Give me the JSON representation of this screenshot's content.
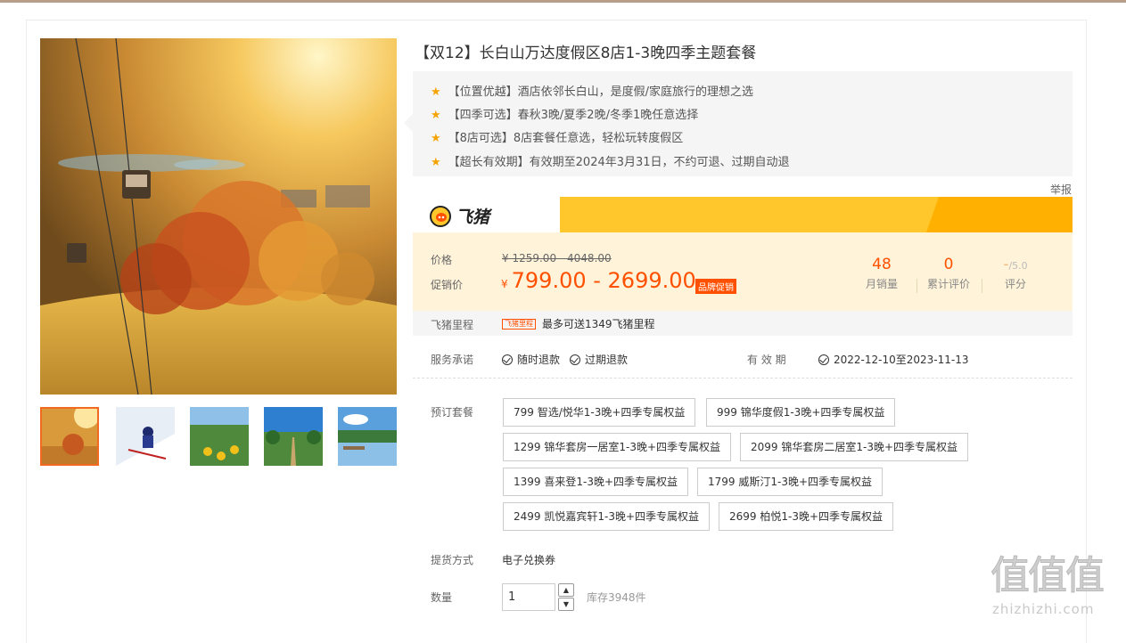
{
  "title": "【双12】长白山万达度假区8店1-3晚四季主题套餐",
  "features": [
    "【位置优越】酒店依邻长白山，是度假/家庭旅行的理想之选",
    "【四季可选】春秋3晚/夏季2晚/冬季1晚任意选择",
    "【8店可选】8店套餐任意选，轻松玩转度假区",
    "【超长有效期】有效期至2024年3月31日，不约可退、过期自动退"
  ],
  "report_label": "举报",
  "brand": {
    "name": "飞猪",
    "icon": "fliggy-logo-icon"
  },
  "price": {
    "price_label": "价格",
    "original": "¥ 1259.00 - 4048.00",
    "promo_label": "促销价",
    "currency": "¥",
    "promo_value": "799.00 - 2699.00",
    "tag": "品牌促销"
  },
  "stats": {
    "monthly_sales_value": "48",
    "monthly_sales_label": "月销量",
    "reviews_value": "0",
    "reviews_label": "累计评价",
    "rating_value": "-",
    "rating_suffix": "/5.0",
    "rating_label": "评分"
  },
  "mileage": {
    "label": "飞猪里程",
    "tag": "飞猪里程",
    "text": "最多可送1349飞猪里程"
  },
  "service": {
    "label": "服务承诺",
    "items": [
      "随时退款",
      "过期退款"
    ],
    "validity_label": "有 效 期",
    "validity_value": "2022-12-10至2023-11-13"
  },
  "package": {
    "label": "预订套餐",
    "options": [
      "799 智选/悦华1-3晚+四季专属权益",
      "999 锦华度假1-3晚+四季专属权益",
      "1299 锦华套房一居室1-3晚+四季专属权益",
      "2099 锦华套房二居室1-3晚+四季专属权益",
      "1399 喜来登1-3晚+四季专属权益",
      "1799 威斯汀1-3晚+四季专属权益",
      "2499 凯悦嘉宾轩1-3晚+四季专属权益",
      "2699 柏悦1-3晚+四季专属权益"
    ]
  },
  "delivery": {
    "label": "提货方式",
    "value": "电子兑换券"
  },
  "quantity": {
    "label": "数量",
    "value": "1",
    "stock": "库存3948件"
  },
  "watermark": {
    "main": "值值值",
    "sub": "zhizhizhi.com"
  },
  "colors": {
    "accent": "#ff5000",
    "banner": "#ffc72c",
    "price_bg": "#fff3d9",
    "star": "#f5a300"
  }
}
